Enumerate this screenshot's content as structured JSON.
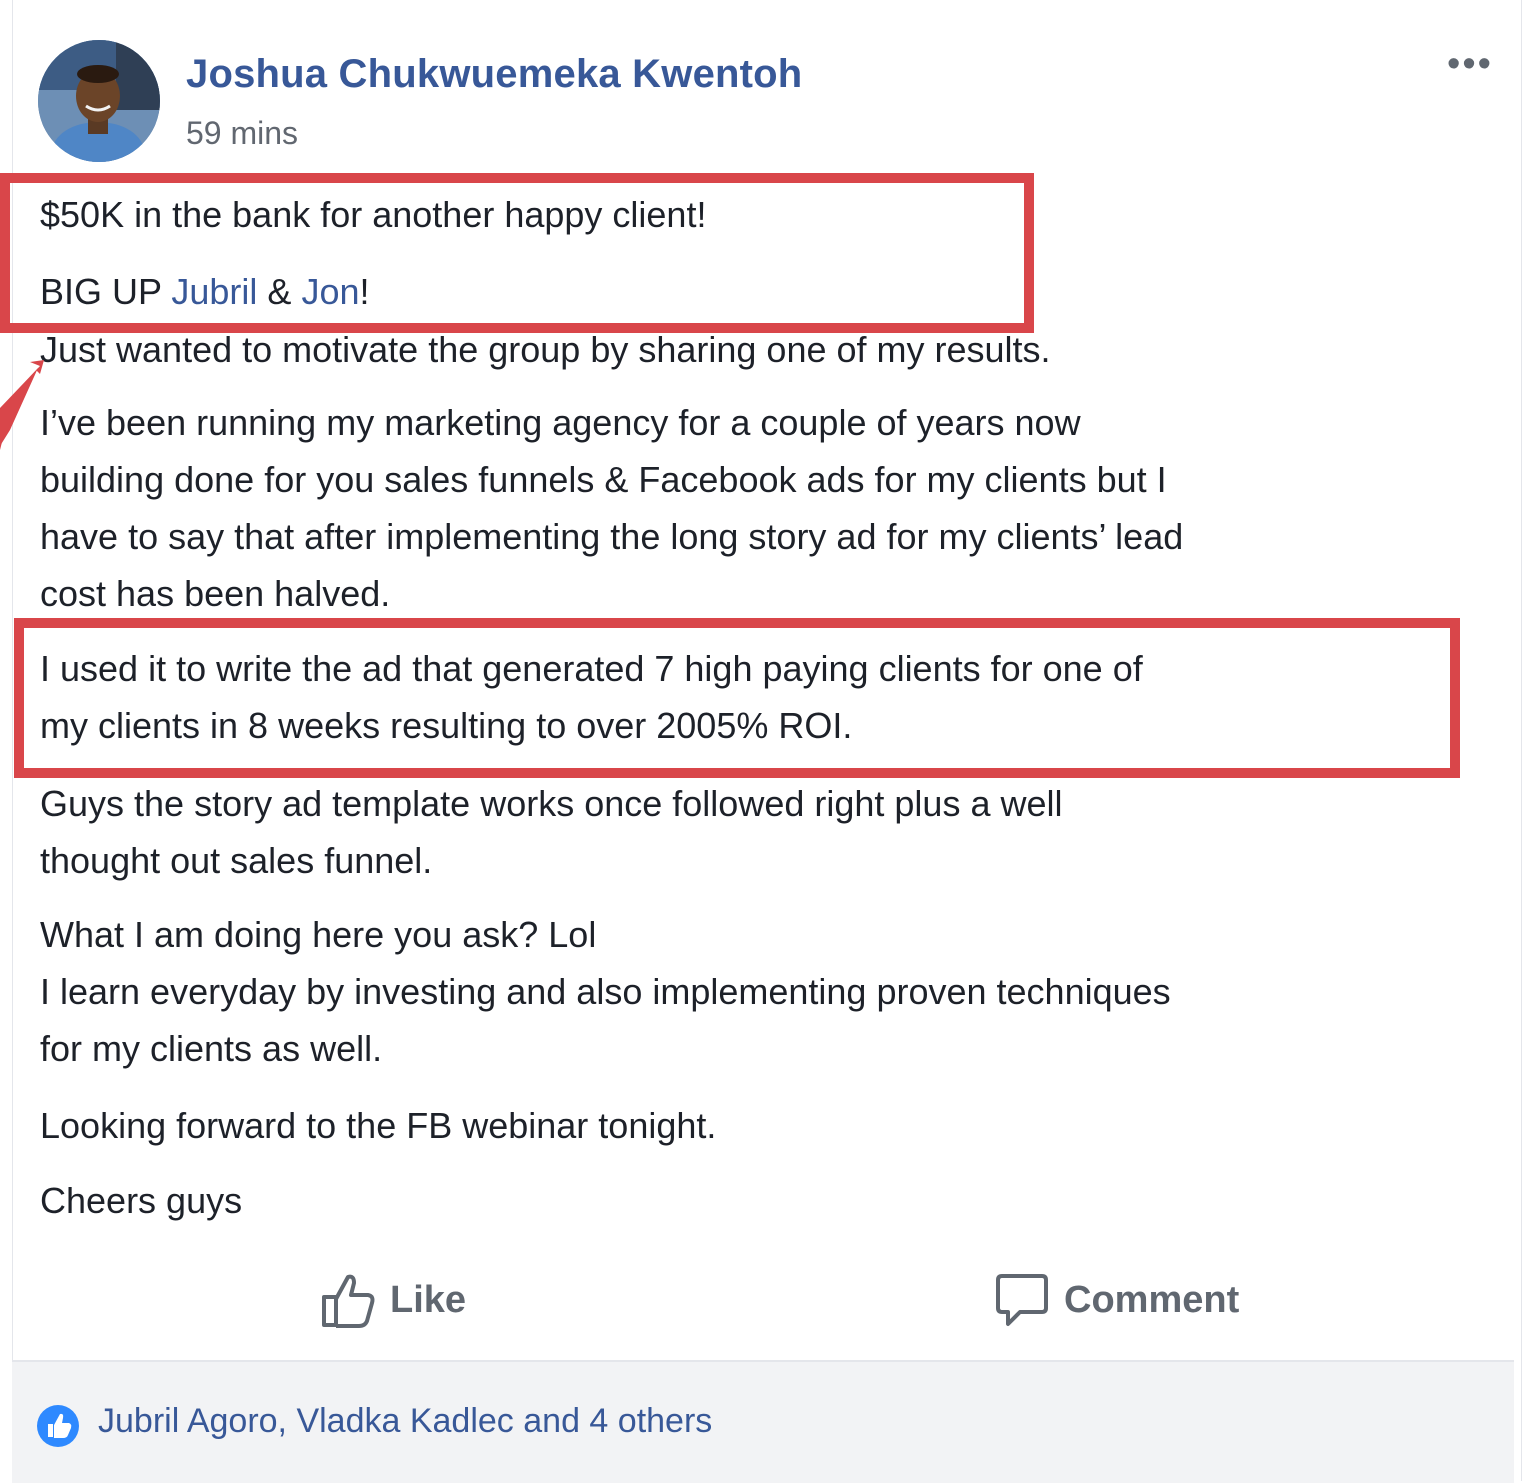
{
  "post": {
    "author": "Joshua Chukwuemeka Kwentoh",
    "time": "59 mins",
    "more_icon": "more-options-icon",
    "line1": "$50K in the bank for another happy client!",
    "bigup": {
      "prefix": "BIG UP ",
      "mention1": "Jubril",
      "amp": " & ",
      "mention2": "Jon",
      "suffix": "!"
    },
    "line3": "Just wanted to motivate the group by sharing one of my results.",
    "para1": [
      "I’ve been running my marketing agency for a couple of years now",
      "building done for you sales funnels & Facebook ads for my clients but I",
      "have to say that after implementing the long story ad for my clients’ lead",
      "cost has been halved."
    ],
    "para2": [
      "I used it to write the ad that generated 7 high paying clients for one of",
      "my clients in 8 weeks resulting to over 2005% ROI."
    ],
    "para3": [
      "Guys the story ad template works once followed right plus a well",
      "thought out sales funnel."
    ],
    "para4": [
      "What I am doing here you ask? Lol",
      "I learn everyday by investing and also implementing proven techniques",
      "for my clients as well."
    ],
    "para5": "Looking forward to the FB webinar tonight.",
    "para6": "Cheers guys"
  },
  "actions": {
    "like": "Like",
    "comment": "Comment"
  },
  "reactions": {
    "summary": "Jubril Agoro, Vladka Kadlec and 4 others"
  },
  "colors": {
    "highlight": "#d9464a",
    "link": "#385898",
    "text": "#1d2129",
    "muted": "#616770"
  }
}
